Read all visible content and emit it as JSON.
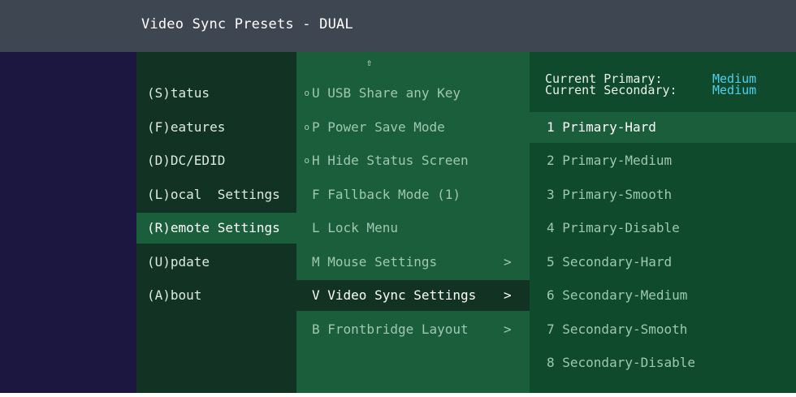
{
  "title": "Video Sync Presets - DUAL",
  "up_arrow": "⇧",
  "main_menu": [
    {
      "label": "(S)tatus"
    },
    {
      "label": "(F)eatures"
    },
    {
      "label": "(D)DC/EDID"
    },
    {
      "label": "(L)ocal  Settings"
    },
    {
      "label": "(R)emote Settings",
      "selected": true
    },
    {
      "label": "(U)pdate"
    },
    {
      "label": "(A)bout"
    }
  ],
  "sub_menu": [
    {
      "bullet": "o",
      "label": "U USB Share any Key"
    },
    {
      "bullet": "o",
      "label": "P Power Save Mode"
    },
    {
      "bullet": "o",
      "label": "H Hide Status Screen"
    },
    {
      "bullet": "",
      "label": "F Fallback Mode (1)"
    },
    {
      "bullet": "",
      "label": "L Lock Menu"
    },
    {
      "bullet": "",
      "label": "M Mouse Settings",
      "arrow": ">"
    },
    {
      "bullet": "",
      "label": "V Video Sync Settings",
      "arrow": ">",
      "selected": true
    },
    {
      "bullet": "",
      "label": "B Frontbridge Layout",
      "arrow": ">"
    }
  ],
  "current": {
    "primary_label": "Current Primary:",
    "primary_value": "Medium",
    "secondary_label": "Current Secondary:",
    "secondary_value": "Medium"
  },
  "presets": [
    {
      "label": "1 Primary-Hard",
      "selected": true
    },
    {
      "label": "2 Primary-Medium"
    },
    {
      "label": "3 Primary-Smooth"
    },
    {
      "label": "4 Primary-Disable"
    },
    {
      "label": "5 Secondary-Hard"
    },
    {
      "label": "6 Secondary-Medium"
    },
    {
      "label": "7 Secondary-Smooth"
    },
    {
      "label": "8 Secondary-Disable"
    }
  ],
  "colors": {
    "background": "#1b1740",
    "titlebar": "#3e4652",
    "main_menu_bg": "#123323",
    "sub_menu_bg": "#1b5e3b",
    "presets_bg": "#0e4a2b",
    "value_accent": "#4fd0ee"
  }
}
